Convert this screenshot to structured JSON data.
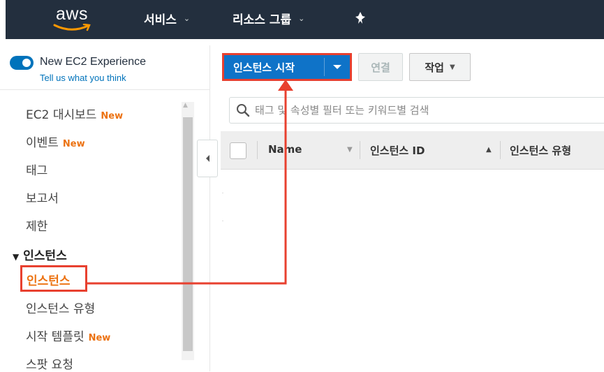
{
  "topnav": {
    "logo_text": "aws",
    "services_label": "서비스",
    "resource_groups_label": "리소스 그룹",
    "pin_icon": "pushpin-icon"
  },
  "sidebar": {
    "experience_title": "New EC2 Experience",
    "experience_link": "Tell us what you think",
    "toggle_on": true,
    "items": [
      {
        "label": "EC2 대시보드",
        "badge": "New"
      },
      {
        "label": "이벤트",
        "badge": "New"
      },
      {
        "label": "태그",
        "badge": ""
      },
      {
        "label": "보고서",
        "badge": ""
      },
      {
        "label": "제한",
        "badge": ""
      }
    ],
    "section_title": "인스턴스",
    "section_items": [
      {
        "label": "인스턴스",
        "active": true,
        "badge": ""
      },
      {
        "label": "인스턴스 유형",
        "badge": ""
      },
      {
        "label": "시작 템플릿",
        "badge": "New"
      },
      {
        "label": "스팟 요청",
        "badge": ""
      }
    ]
  },
  "toolbar": {
    "launch_label": "인스턴스 시작",
    "connect_label": "연결",
    "actions_label": "작업"
  },
  "search": {
    "placeholder": "태그 및 속성별 필터 또는 키워드별 검색"
  },
  "table": {
    "columns": [
      "Name",
      "인스턴스 ID",
      "인스턴스 유형"
    ]
  },
  "colors": {
    "nav_bg": "#232f3e",
    "primary": "#0f73c8",
    "accent_orange": "#ec7211",
    "annotation_red": "#e8402f"
  }
}
